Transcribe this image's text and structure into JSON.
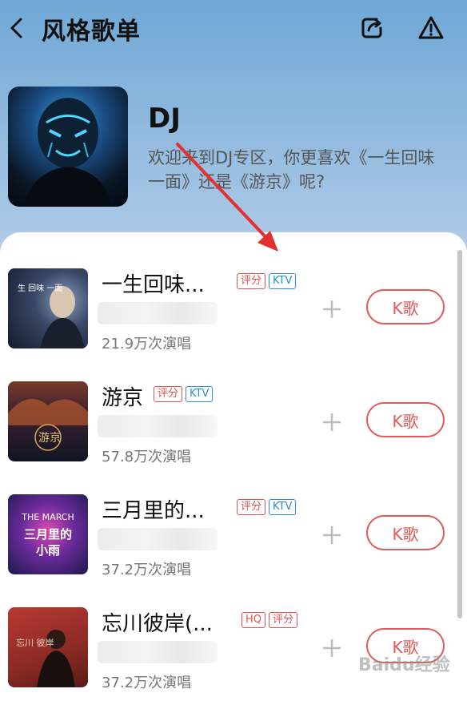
{
  "header": {
    "title": "风格歌单",
    "back_icon": "chevron-left-icon",
    "share_icon": "share-icon",
    "report_icon": "warning-icon"
  },
  "hero": {
    "name": "DJ",
    "description": "欢迎来到DJ专区，你更喜欢《一生回味一面》还是《游京》呢?"
  },
  "songs": [
    {
      "title": "一生回味...",
      "badges": [
        "评分",
        "KTV"
      ],
      "plays": "21.9万次演唱",
      "cover_text": "生 回味 一面"
    },
    {
      "title": "游京",
      "badges": [
        "评分",
        "KTV"
      ],
      "plays": "57.8万次演唱",
      "cover_text": "游京"
    },
    {
      "title": "三月里的...",
      "badges": [
        "评分",
        "KTV"
      ],
      "plays": "37.2万次演唱",
      "cover_text": "THE MARCH 三月里的 小雨"
    },
    {
      "title": "忘川彼岸(...",
      "badges": [
        "HQ",
        "评分"
      ],
      "plays": "37.2万次演唱",
      "cover_text": "忘川 彼岸"
    }
  ],
  "buttons": {
    "sing": "K歌",
    "add": "+"
  },
  "colors": {
    "accent": "#e05a5a",
    "ktv": "#2a8fd1"
  },
  "watermark": "Baidu经验"
}
